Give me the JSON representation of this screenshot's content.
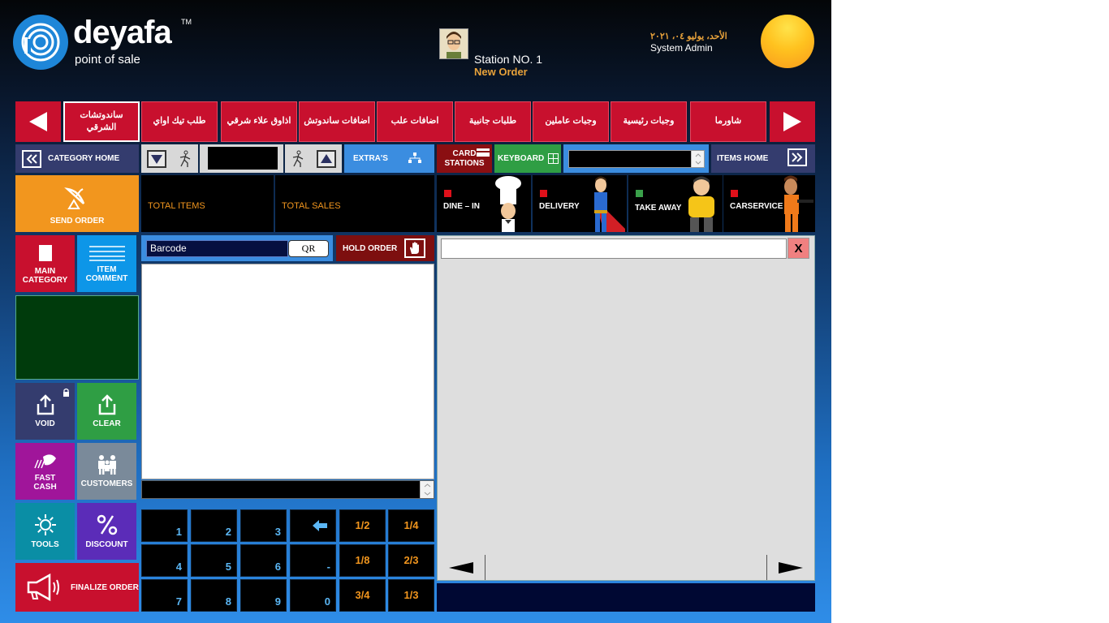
{
  "header": {
    "logo_text": "deyafa",
    "logo_tm": "TM",
    "logo_sub": "point of sale",
    "station_label": "Station NO.  1",
    "order_status": "New Order",
    "date": "الأحد، يوليو ٠٤، ٢٠٢١",
    "user": "System Admin"
  },
  "categories": [
    {
      "label": "ساندوتشات الشرقي",
      "active": true
    },
    {
      "label": "طلب تيك اواي"
    },
    {
      "label": "اذاوق علاء شرقي"
    },
    {
      "label": "اضافات ساندوتش"
    },
    {
      "label": "اضافات علب"
    },
    {
      "label": "طلبات جانبية"
    },
    {
      "label": "وجبات عاملين"
    },
    {
      "label": "وجبات رئيسية"
    },
    {
      "label": "شاورما"
    }
  ],
  "toolbar": {
    "category_home": "CATEGORY HOME",
    "extras": "EXTRA'S",
    "card_stations": "CARD\nSTATIONS",
    "card_line1": "CARD",
    "card_line2": "STATIONS",
    "keyboard": "KEYBOARD",
    "items_home": "ITEMS HOME"
  },
  "send_order": "SEND ORDER",
  "totals": {
    "total_items": "TOTAL ITEMS",
    "total_sales": "TOTAL SALES"
  },
  "order_types": [
    {
      "label": "DINE – IN",
      "dot": "#e0101a"
    },
    {
      "label": "DELIVERY",
      "dot": "#e0101a"
    },
    {
      "label": "TAKE AWAY",
      "dot": "#3aa04a"
    },
    {
      "label": "CARSERVICE",
      "dot": "#e0101a"
    }
  ],
  "tiles": {
    "main_category_1": "MAIN",
    "main_category_2": "CATEGORY",
    "item_comment_1": "ITEM",
    "item_comment_2": "COMMENT",
    "void": "VOID",
    "clear": "CLEAR",
    "fast_cash_1": "FAST",
    "fast_cash_2": "CASH",
    "customers": "CUSTOMERS",
    "tools": "TOOLS",
    "discount": "DISCOUNT",
    "finalize": "FINALIZE ORDER"
  },
  "barcode": {
    "placeholder": "Barcode",
    "qr_label": "QR"
  },
  "hold_order": "HOLD ORDER",
  "numpad": {
    "k1": "1",
    "k2": "2",
    "k3": "3",
    "k4": "4",
    "k5": "5",
    "k6": "6",
    "k7": "7",
    "k8": "8",
    "k9": "9",
    "k0": "0",
    "kdash": "-",
    "f12": "1/2",
    "f14": "1/4",
    "f18": "1/8",
    "f23": "2/3",
    "f34": "3/4",
    "f13": "1/3"
  },
  "items_panel": {
    "close_label": "X"
  },
  "colors": {
    "accent_red": "#c8102e",
    "accent_orange": "#f2961e",
    "accent_blue": "#3b8de0",
    "accent_green": "#3aa04a"
  }
}
